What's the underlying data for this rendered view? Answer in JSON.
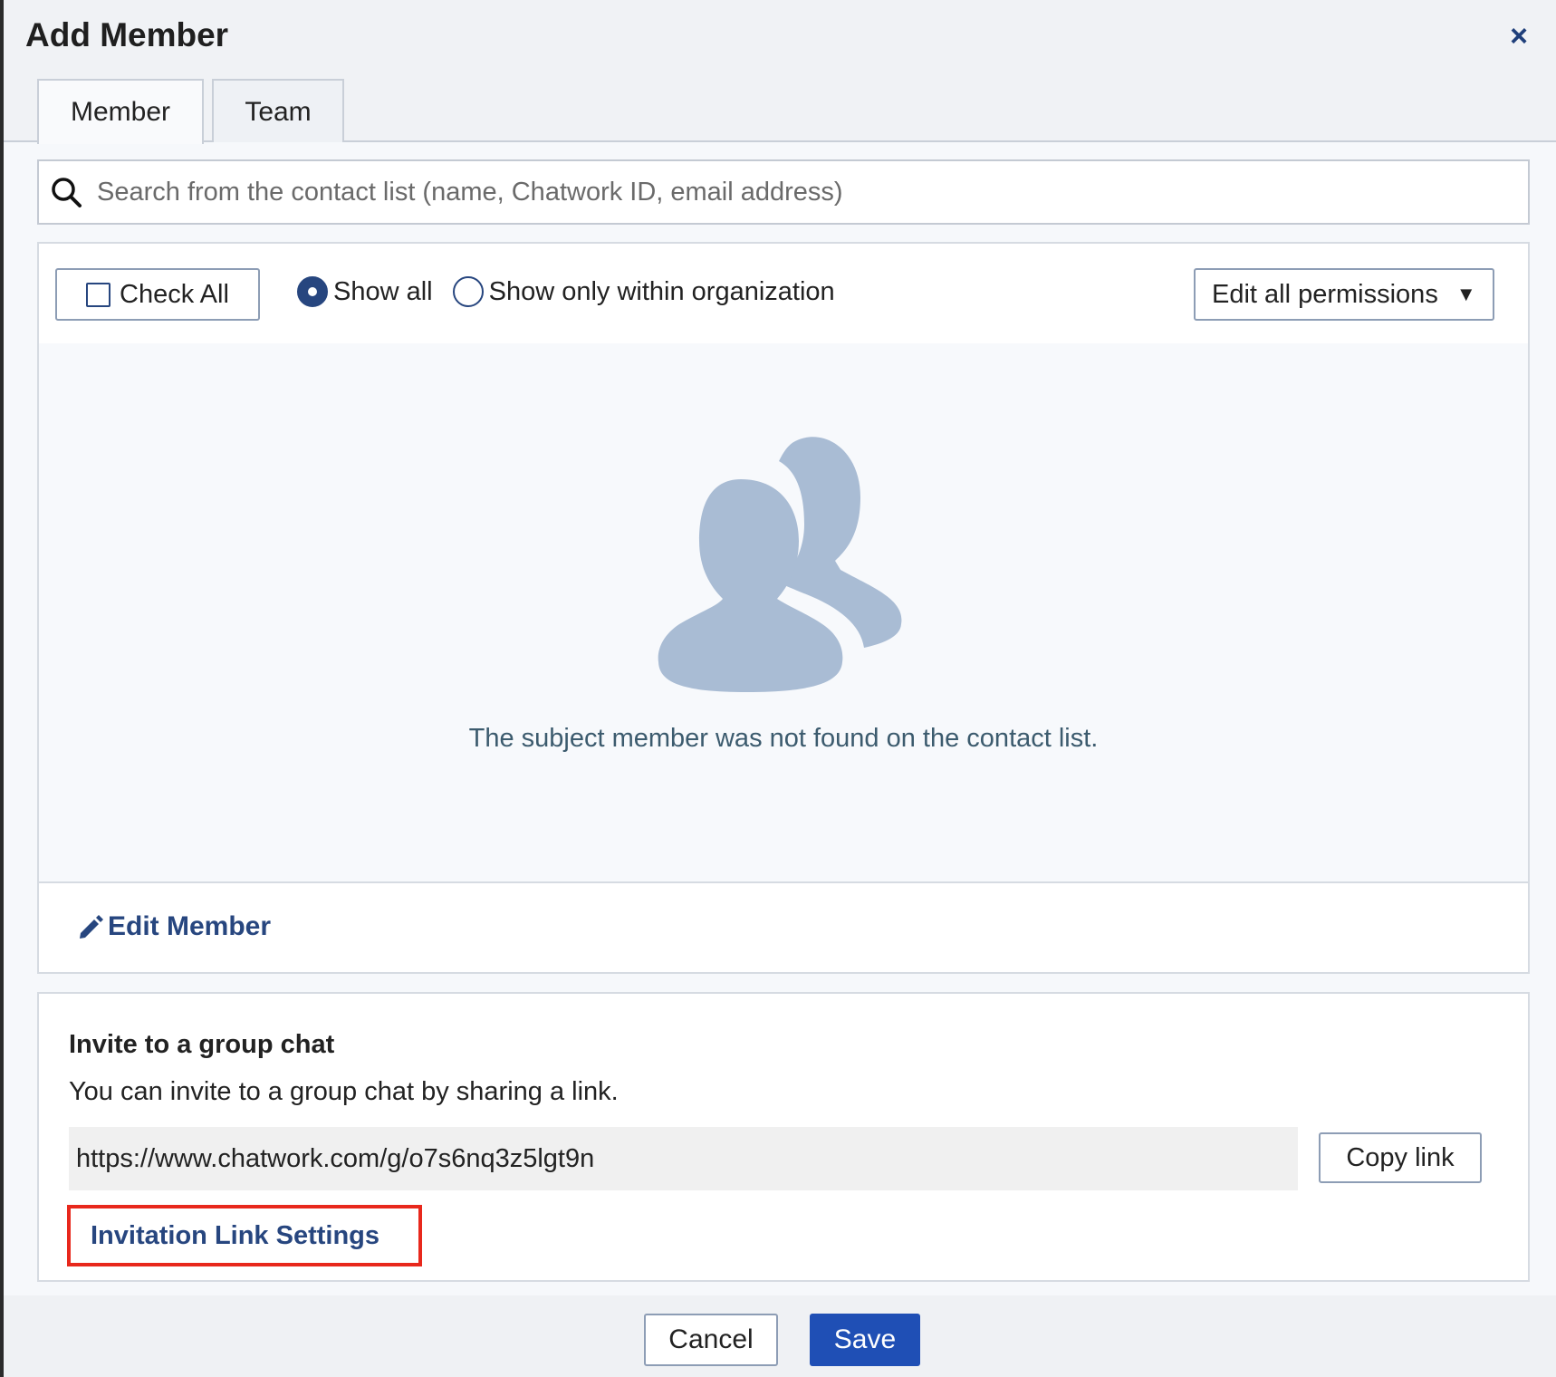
{
  "dialog": {
    "title": "Add Member",
    "close_icon": "close-icon"
  },
  "tabs": [
    {
      "label": "Member",
      "active": true
    },
    {
      "label": "Team",
      "active": false
    }
  ],
  "search": {
    "placeholder": "Search from the contact list (name, Chatwork ID, email address)",
    "icon": "search-icon"
  },
  "toolbar": {
    "check_all_label": "Check All",
    "radios": [
      {
        "label": "Show all",
        "selected": true
      },
      {
        "label": "Show only within organization",
        "selected": false
      }
    ],
    "permissions_label": "Edit all permissions",
    "permissions_icon": "caret-down-icon"
  },
  "empty_state": {
    "icon": "people-icon",
    "message": "The subject member was not found on the contact list."
  },
  "edit_member": {
    "label": "Edit Member",
    "icon": "pencil-icon"
  },
  "invite": {
    "title": "Invite to a group chat",
    "description": "You can invite to a group chat by sharing a link.",
    "link": "https://www.chatwork.com/g/o7s6nq3z5lgt9n",
    "copy_label": "Copy link",
    "settings_label": "Invitation Link Settings"
  },
  "footer": {
    "cancel_label": "Cancel",
    "save_label": "Save"
  },
  "colors": {
    "accent": "#27467f",
    "primary_button": "#1f4fb5",
    "highlight_box": "#e8281c",
    "icon_fill": "#a9bcd4"
  }
}
